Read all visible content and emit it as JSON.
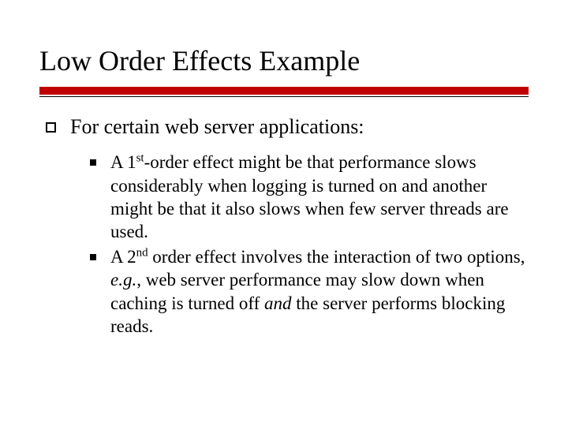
{
  "title": "Low Order Effects Example",
  "lvl1_text": "For certain web server applications:",
  "b1_pre": "A 1",
  "b1_sup": "st",
  "b1_post": "-order effect might be that performance slows considerably when logging is turned on and another might be that it also slows when few server threads are used.",
  "b2_pre": "A 2",
  "b2_sup": "nd",
  "b2_mid": " order effect involves the interaction of two options, ",
  "b2_eg": "e.g.",
  "b2_mid2": ", web server performance may slow down when caching is turned off ",
  "b2_and": "and",
  "b2_post": " the server performs blocking reads."
}
